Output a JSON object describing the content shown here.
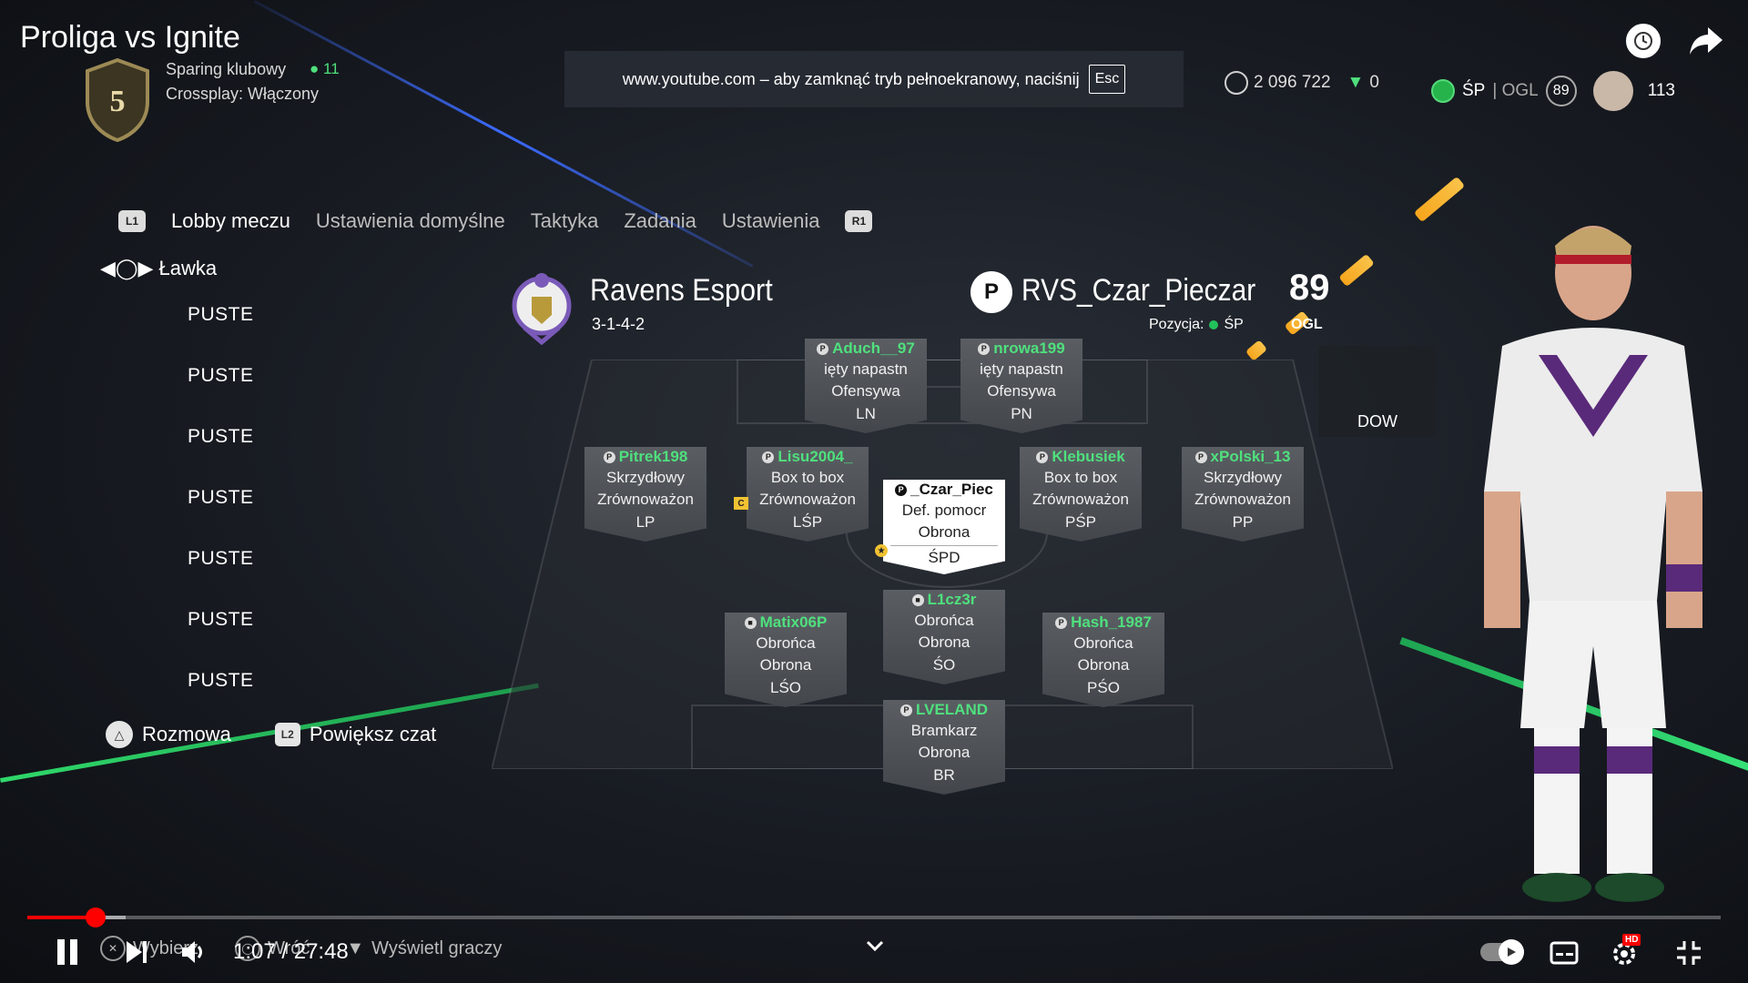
{
  "header": {
    "title": "Proliga vs Ignite",
    "division": "5",
    "mode": "Sparing klubowy",
    "player_count": "11",
    "crossplay": "Crossplay: Włączony"
  },
  "banner": {
    "text": "www.youtube.com – aby zamknąć tryb pełnoekranowy, naciśnij",
    "key": "Esc"
  },
  "status": {
    "coins": "2 096 722",
    "points": "0",
    "position": "ŚP",
    "separator": "| OGL",
    "ogl": "89",
    "count": "113"
  },
  "tabs": {
    "left_button": "L1",
    "right_button": "R1",
    "items": [
      "Lobby meczu",
      "Ustawienia domyślne",
      "Taktyka",
      "Zadania",
      "Ustawienia"
    ]
  },
  "bench": {
    "title": "Ławka",
    "items": [
      "PUSTE",
      "PUSTE",
      "PUSTE",
      "PUSTE",
      "PUSTE",
      "PUSTE",
      "PUSTE"
    ]
  },
  "actions": {
    "chat": "Rozmowa",
    "chat_button": "△",
    "enlarge": "Powiększ czat",
    "enlarge_button": "L2"
  },
  "team": {
    "name": "Ravens Esport",
    "formation": "3-1-4-2",
    "player": "RVS_Czar_Pieczar",
    "position_label": "Pozycja:",
    "position": "ŚP",
    "rating": "89",
    "rating_label": "OGL"
  },
  "cards": [
    {
      "name": "Aduch__97",
      "role1": "ięty napastn",
      "role2": "Ofensywa",
      "pos": "LN"
    },
    {
      "name": "nrowa199",
      "role1": "ięty napastn",
      "role2": "Ofensywa",
      "pos": "PN"
    },
    {
      "name": "Pitrek198",
      "role1": "Skrzydłowy",
      "role2": "Zrównoważon",
      "pos": "LP"
    },
    {
      "name": "Lisu2004_",
      "role1": "Box to box",
      "role2": "Zrównoważon",
      "pos": "LŚP"
    },
    {
      "name": "_Czar_Piec",
      "role1": "Def. pomocr",
      "role2": "Obrona",
      "pos": "ŚPD"
    },
    {
      "name": "Klebusiek",
      "role1": "Box to box",
      "role2": "Zrównoważon",
      "pos": "PŚP"
    },
    {
      "name": "xPolski_13",
      "role1": "Skrzydłowy",
      "role2": "Zrównoważon",
      "pos": "PP"
    },
    {
      "name": "L1cz3r",
      "role1": "Obrońca",
      "role2": "Obrona",
      "pos": "ŚO"
    },
    {
      "name": "Matix06P",
      "role1": "Obrońca",
      "role2": "Obrona",
      "pos": "LŚO"
    },
    {
      "name": "Hash_1987",
      "role1": "Obrońca",
      "role2": "Obrona",
      "pos": "PŚO"
    },
    {
      "name": "LVELAND",
      "role1": "Bramkarz",
      "role2": "Obrona",
      "pos": "BR"
    }
  ],
  "captain_badge": "C",
  "dow": "DOW",
  "video": {
    "current": "1:07",
    "duration": "27:48",
    "time_display": "1:07 / 27:48",
    "progress": 0.04,
    "hints": [
      "Wybierz",
      "Wróć",
      "Wyświetl graczy"
    ],
    "quality_badge": "HD"
  },
  "colors": {
    "accent_green": "#4fe07d",
    "progress_red": "#ff0000",
    "blue_beam": "#3b6bff"
  }
}
